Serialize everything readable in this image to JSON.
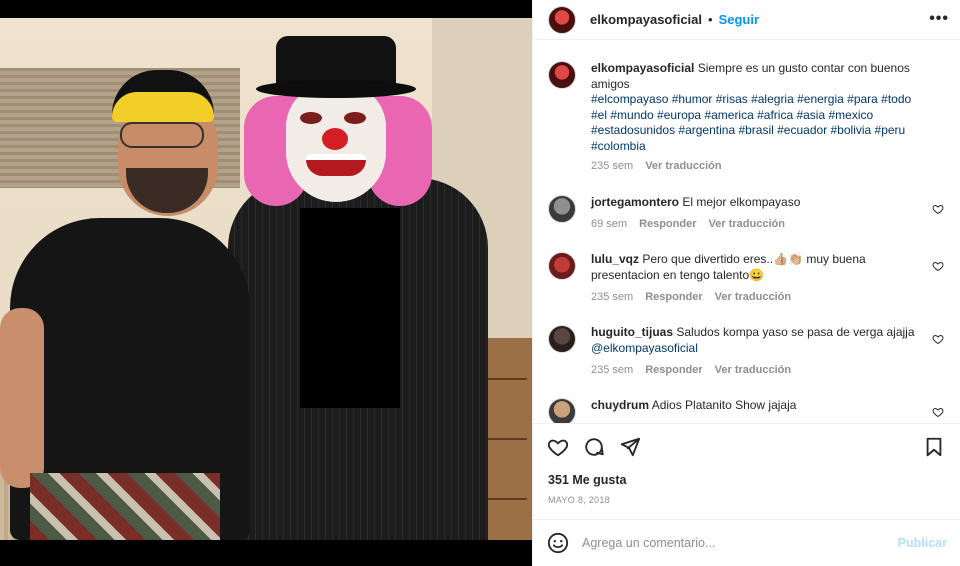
{
  "post": {
    "username": "elkompayasoficial",
    "dot": "•",
    "follow": "Seguir",
    "more": "•••",
    "photo_alt": "photo"
  },
  "caption": {
    "username": "elkompayasoficial",
    "text": "Siempre es un gusto contar con buenos amigos",
    "hashtags": "#elcompayaso #humor #risas #alegria #energia #para #todo #el #mundo #europa #america #africa #asia #mexico #estadosunidos #argentina #brasil #ecuador #bolivia #peru #colombia",
    "time": "235 sem",
    "translate": "Ver traducción"
  },
  "comments": [
    {
      "username": "jortegamontero",
      "text": "El mejor elkompayaso",
      "time": "69 sem",
      "reply": "Responder",
      "translate": "Ver traducción"
    },
    {
      "username": "lulu_vqz",
      "text": "Pero que divertido eres..👍🏼👏🏼 muy buena presentacion en tengo talento😀",
      "time": "235 sem",
      "reply": "Responder",
      "translate": "Ver traducción"
    },
    {
      "username": "huguito_tijuas",
      "text": "Saludos kompa yaso se pasa de verga ajajja",
      "mention": "@elkompayasoficial",
      "time": "235 sem",
      "reply": "Responder",
      "translate": "Ver traducción"
    },
    {
      "username": "chuydrum",
      "text": "Adios Platanito Show jajaja"
    }
  ],
  "stats": {
    "likes": "351 Me gusta",
    "date": "MAYO 8, 2018"
  },
  "add_comment": {
    "placeholder": "Agrega un comentario...",
    "publish": "Publicar"
  },
  "icons": {
    "like": "heart-icon",
    "comment": "comment-icon",
    "share": "paper-plane-icon",
    "save": "bookmark-icon",
    "emoji": "emoji-icon",
    "options": "more-icon"
  },
  "colors": {
    "link_blue": "#0095f6",
    "hashtag": "#00376b",
    "muted": "#8e8e8e",
    "publish_disabled": "#b2dffc"
  }
}
